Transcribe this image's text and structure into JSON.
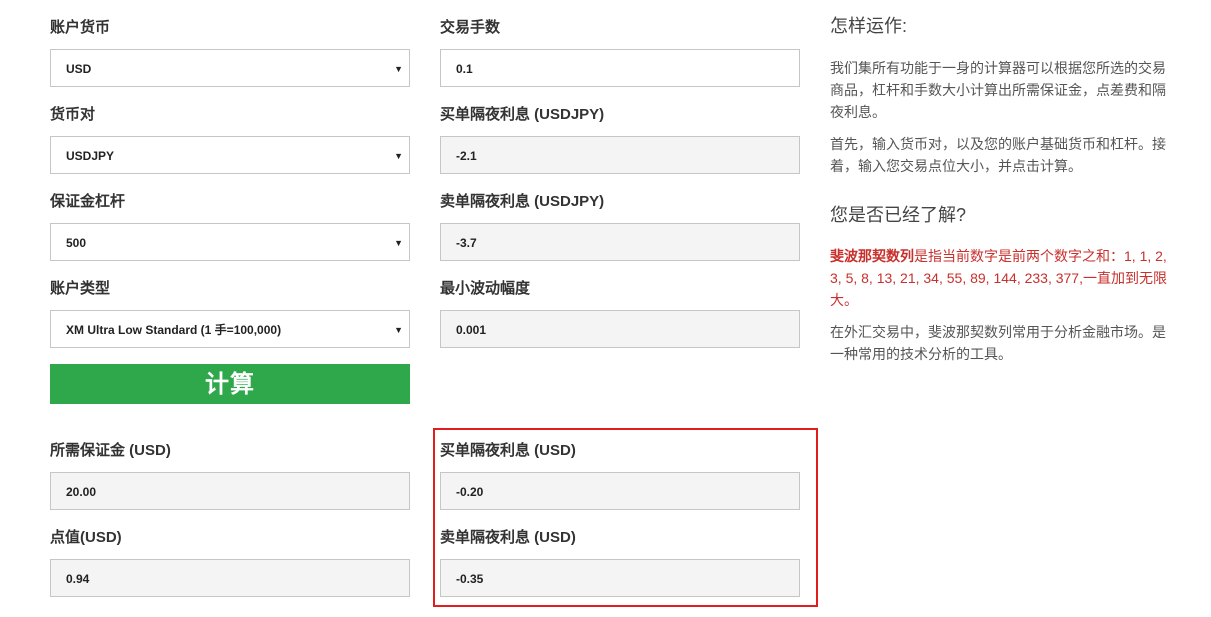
{
  "left_form": {
    "account_currency": {
      "label": "账户货币",
      "value": "USD"
    },
    "currency_pair": {
      "label": "货币对",
      "value": "USDJPY"
    },
    "margin_leverage": {
      "label": "保证金杠杆",
      "value": "500"
    },
    "account_type": {
      "label": "账户类型",
      "value": "XM Ultra Low Standard (1 手=100,000)"
    },
    "calculate_label": "计算"
  },
  "right_form": {
    "trade_size": {
      "label": "交易手数",
      "value": "0.1"
    },
    "long_swap_pair": {
      "label": "买单隔夜利息 (USDJPY)",
      "value": "-2.1"
    },
    "short_swap_pair": {
      "label": "卖单隔夜利息 (USDJPY)",
      "value": "-3.7"
    },
    "min_tick": {
      "label": "最小波动幅度",
      "value": "0.001"
    }
  },
  "results": {
    "required_margin": {
      "label": "所需保证金 (USD)",
      "value": "20.00"
    },
    "pip_value": {
      "label": "点值(USD)",
      "value": "0.94"
    },
    "long_swap_usd": {
      "label": "买单隔夜利息 (USD)",
      "value": "-0.20"
    },
    "short_swap_usd": {
      "label": "卖单隔夜利息 (USD)",
      "value": "-0.35"
    }
  },
  "sidebar": {
    "how_title": "怎样运作:",
    "how_p1_lines": [
      "我们集所有功能于一身的计算器可以根据您所选的交易",
      "商品，杠杆和手数大小计算出所需保证金，点差费和隔",
      "夜利息。"
    ],
    "how_p2_lines": [
      "首先，输入货币对，以及您的账户基础货币和杠杆。接",
      "着，输入您交易点位大小，并点击计算。"
    ],
    "know_title": "您是否已经了解?",
    "fib_bold": "斐波那契数列",
    "fib_lines": [
      "是指当前数字是前两个数字之和：1, 1, 2,",
      "3, 5, 8, 13, 21, 34, 55, 89, 144, 233, 377,一直加到无限",
      "大。"
    ],
    "fib_p2_lines": [
      "在外汇交易中，斐波那契数列常用于分析金融市场。是",
      "一种常用的技术分析的工具。"
    ]
  },
  "colors": {
    "calc_button": "#2ea84b",
    "highlight_border": "#e11d1d",
    "fib_text": "#c8302c"
  }
}
